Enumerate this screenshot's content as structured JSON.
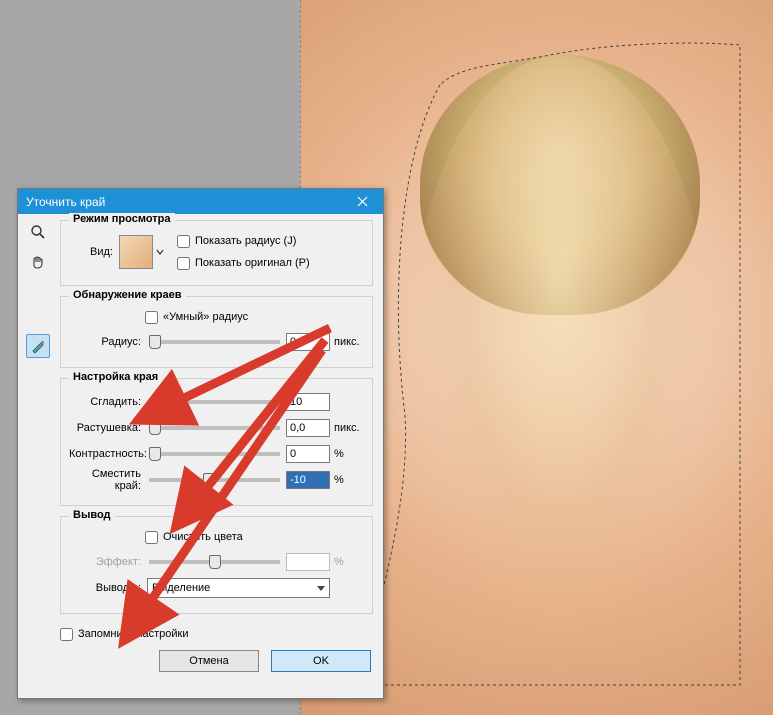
{
  "dialog": {
    "title": "Уточнить край",
    "view_mode": {
      "group_title": "Режим просмотра",
      "view_label": "Вид:",
      "show_radius": "Показать радиус (J)",
      "show_original": "Показать оригинал (P)"
    },
    "edge_detect": {
      "group_title": "Обнаружение краев",
      "smart_radius": "«Умный» радиус",
      "radius_label": "Радиус:",
      "radius_value": "0,0",
      "radius_unit": "пикс."
    },
    "edge_adjust": {
      "group_title": "Настройка края",
      "smooth_label": "Сгладить:",
      "smooth_value": "10",
      "feather_label": "Растушевка:",
      "feather_value": "0,0",
      "feather_unit": "пикс.",
      "contrast_label": "Контрастность:",
      "contrast_value": "0",
      "contrast_unit": "%",
      "shift_label": "Сместить край:",
      "shift_value": "-10",
      "shift_unit": "%"
    },
    "output": {
      "group_title": "Вывод",
      "cleanup": "Очистить цвета",
      "effect_label": "Эффект:",
      "effect_unit": "%",
      "output_to_label": "Вывод в:",
      "output_to_value": "Выделение"
    },
    "remember": "Запомнить настройки",
    "cancel": "Отмена",
    "ok": "OK"
  }
}
